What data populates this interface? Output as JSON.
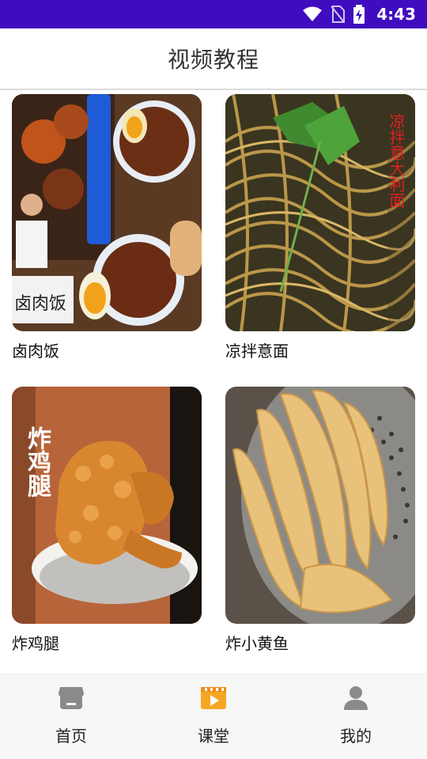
{
  "status_bar": {
    "time": "4:43",
    "bg_color": "#3f0cbf",
    "icons": [
      "wifi-icon",
      "no-sim-icon",
      "battery-charging-icon"
    ]
  },
  "header": {
    "title": "视频教程"
  },
  "videos": [
    {
      "title": "卤肉饭",
      "overlay_text": "卤肉饭"
    },
    {
      "title": "凉拌意面",
      "overlay_text": "凉拌意大利面"
    },
    {
      "title": "炸鸡腿",
      "overlay_text": "炸鸡腿"
    },
    {
      "title": "炸小黄鱼",
      "overlay_text": ""
    }
  ],
  "bottom_nav": {
    "items": [
      {
        "label": "首页",
        "icon": "store-icon",
        "active": false
      },
      {
        "label": "课堂",
        "icon": "video-play-icon",
        "active": true
      },
      {
        "label": "我的",
        "icon": "user-icon",
        "active": false
      }
    ],
    "active_color": "#f5a623",
    "inactive_color": "#8a8a8a"
  }
}
